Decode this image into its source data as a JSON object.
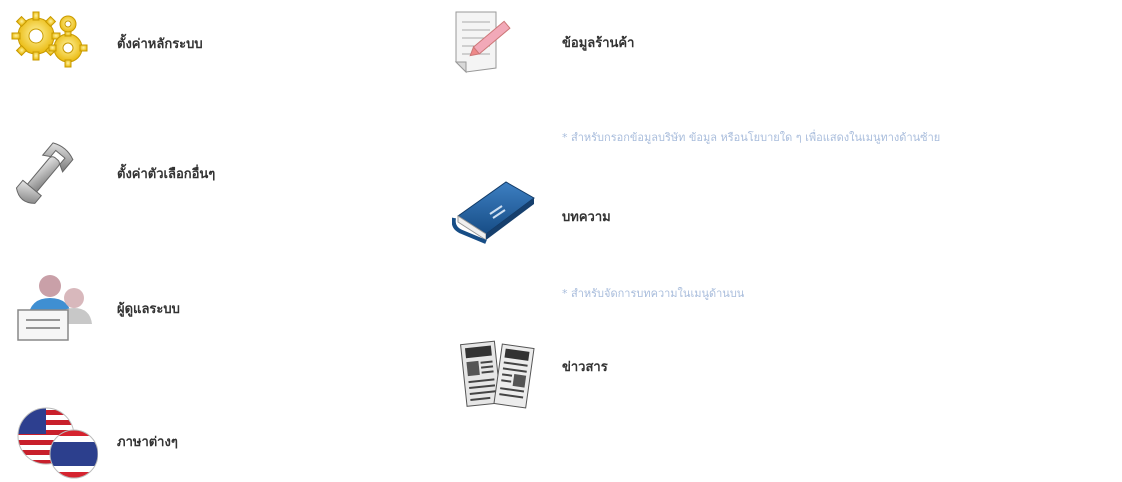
{
  "left_menu": {
    "items": [
      {
        "label": "ตั้งค่าหลักระบบ",
        "icon": "gears-icon"
      },
      {
        "label": "ตั้งค่าตัวเลือกอื่นๆ",
        "icon": "wrench-icon"
      },
      {
        "label": "ผู้ดูแลระบบ",
        "icon": "users-icon"
      },
      {
        "label": "ภาษาต่างๆ",
        "icon": "flags-icon"
      }
    ]
  },
  "right_menu": {
    "items": [
      {
        "label": "ข้อมูลร้านค้า",
        "icon": "document-edit-icon"
      },
      {
        "label": "บทความ",
        "icon": "book-icon"
      },
      {
        "label": "ข่าวสาร",
        "icon": "newspaper-icon"
      }
    ],
    "notes": {
      "store_info": "* สำหรับกรอกข้อมูลบริษัท ข้อมูล หรือนโยบายใด ๆ เพื่อแสดงในเมนูทางด้านซ้าย",
      "articles": "* สำหรับจัดการบทความในเมนูด้านบน"
    }
  },
  "colors": {
    "label": "#333333",
    "note": "#a9bddc",
    "gear": "#f5c518",
    "book": "#1f5fa0"
  }
}
